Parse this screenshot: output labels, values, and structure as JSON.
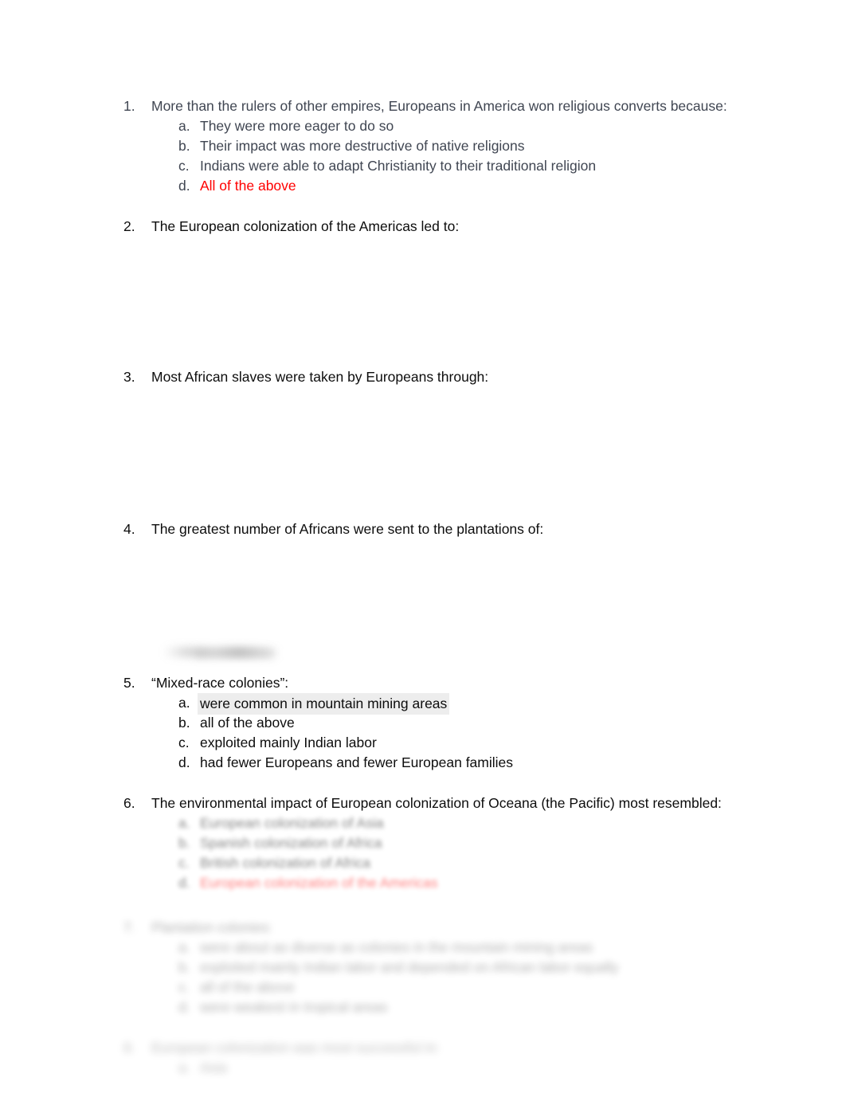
{
  "document": {
    "type": "multiple-choice-quiz",
    "page_background": "#ffffff",
    "answer_highlight_color": "#ff0000",
    "option_highlight_background": "#ededed"
  },
  "questions": [
    {
      "number": "1.",
      "text": "More than the rulers of other empires, Europeans in America won religious converts because:",
      "tone": "gray",
      "options": [
        {
          "letter": "a.",
          "text": "They were more eager to do so",
          "state": "normal"
        },
        {
          "letter": "b.",
          "text": "Their impact was more destructive of native religions",
          "state": "normal"
        },
        {
          "letter": "c.",
          "text": "Indians were able to adapt Christianity to their traditional religion",
          "state": "normal"
        },
        {
          "letter": "d.",
          "text": "All of the above",
          "state": "answer"
        }
      ]
    },
    {
      "number": "2.",
      "text": "The European colonization of the Americas led to:",
      "tone": "black",
      "options": []
    },
    {
      "number": "3.",
      "text": "Most African slaves were taken by Europeans through:",
      "tone": "black",
      "options": []
    },
    {
      "number": "4.",
      "text": "The greatest number of Africans were sent to the plantations of:",
      "tone": "black",
      "options": []
    },
    {
      "number": "5.",
      "text": "“Mixed-race colonies”:",
      "tone": "black",
      "options": [
        {
          "letter": "a.",
          "text": "were common in mountain mining areas",
          "state": "highlighted"
        },
        {
          "letter": "b.",
          "text": "all of the above",
          "state": "normal"
        },
        {
          "letter": "c.",
          "text": "exploited mainly Indian labor",
          "state": "normal"
        },
        {
          "letter": "d.",
          "text": "had fewer Europeans and fewer European families",
          "state": "normal"
        }
      ]
    },
    {
      "number": "6.",
      "text": "The environmental impact of European colonization of Oceana (the Pacific) most resembled:",
      "tone": "black",
      "options": [
        {
          "letter": "a.",
          "text": "European colonization of Asia",
          "state": "blurred"
        },
        {
          "letter": "b.",
          "text": "Spanish colonization of Africa",
          "state": "blurred"
        },
        {
          "letter": "c.",
          "text": "British colonization of Africa",
          "state": "blurred"
        },
        {
          "letter": "d.",
          "text": "European colonization of the Americas",
          "state": "blurred-answer"
        }
      ]
    },
    {
      "number": "7.",
      "text": "Plantation colonies:",
      "tone": "black",
      "options": [
        {
          "letter": "a.",
          "text": "were about as diverse as colonies in the mountain mining areas",
          "state": "blurred"
        },
        {
          "letter": "b.",
          "text": "exploited mainly Indian labor and depended on African labor equally",
          "state": "blurred"
        },
        {
          "letter": "c.",
          "text": "all of the above",
          "state": "blurred"
        },
        {
          "letter": "d.",
          "text": "were weakest in tropical areas",
          "state": "blurred"
        }
      ]
    },
    {
      "number": "8.",
      "text": "European colonization was most successful in:",
      "tone": "black",
      "options": [
        {
          "letter": "a.",
          "text": "Asia",
          "state": "blurred"
        }
      ]
    }
  ]
}
